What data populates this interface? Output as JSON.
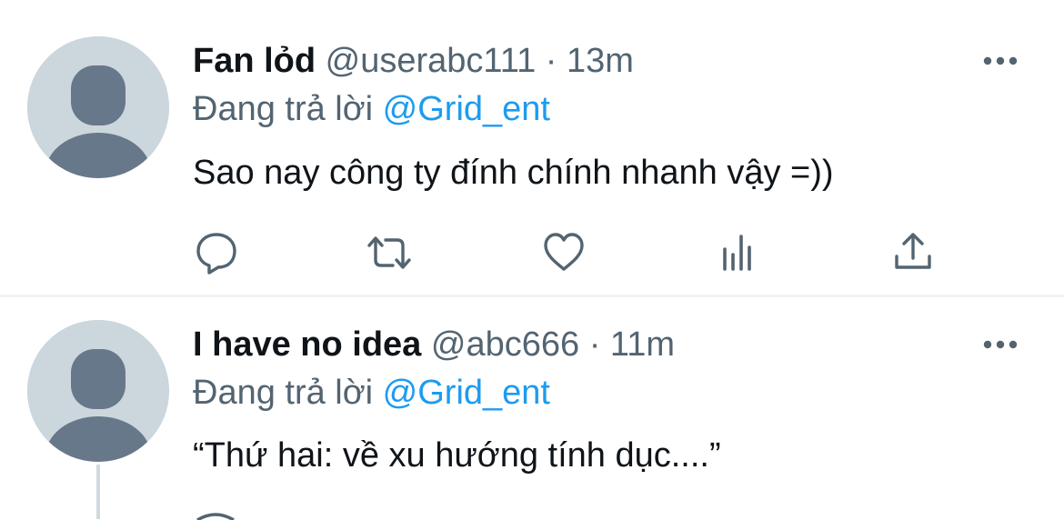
{
  "tweets": [
    {
      "display_name": "Fan lỏd",
      "handle": "@userabc111",
      "separator": "·",
      "time": "13m",
      "reply_prefix": "Đang trả lời",
      "reply_to": "@Grid_ent",
      "text": "Sao nay công ty đính chính nhanh vậy =))",
      "avatar_icon": "default-avatar-icon",
      "more_icon": "more-horizontal-icon",
      "actions": [
        {
          "name": "reply",
          "icon": "reply-bubble-icon"
        },
        {
          "name": "retweet",
          "icon": "retweet-icon"
        },
        {
          "name": "like",
          "icon": "heart-icon"
        },
        {
          "name": "stats",
          "icon": "analytics-icon"
        },
        {
          "name": "share",
          "icon": "share-icon"
        }
      ]
    },
    {
      "display_name": "I have no idea",
      "handle": "@abc666",
      "separator": "·",
      "time": "11m",
      "reply_prefix": "Đang trả lời",
      "reply_to": "@Grid_ent",
      "text": "“Thứ hai: về xu hướng tính dục....”",
      "avatar_icon": "default-avatar-icon",
      "more_icon": "more-horizontal-icon"
    }
  ],
  "colors": {
    "text_primary": "#0f1419",
    "text_secondary": "#536471",
    "accent": "#1d9bf0",
    "divider": "#eff3f4",
    "avatar_bg": "#ccd6dd",
    "avatar_fg": "#66788a"
  }
}
